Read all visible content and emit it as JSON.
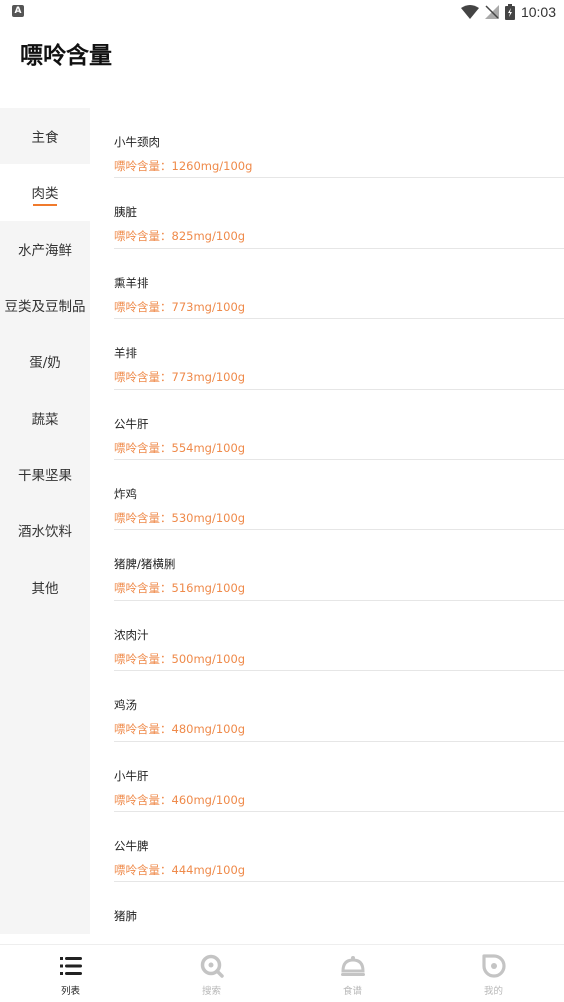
{
  "status_bar": {
    "time": "10:03",
    "left_badge": "A"
  },
  "app": {
    "title": "嘌呤含量"
  },
  "sidebar": {
    "items": [
      {
        "label": "主食"
      },
      {
        "label": "肉类"
      },
      {
        "label": "水产海鲜"
      },
      {
        "label": "豆类及豆制品"
      },
      {
        "label": "蛋/奶"
      },
      {
        "label": "蔬菜"
      },
      {
        "label": "干果坚果"
      },
      {
        "label": "酒水饮料"
      },
      {
        "label": "其他"
      }
    ],
    "active_index": 1
  },
  "list": {
    "items": [
      {
        "name": "小牛颈肉",
        "purine": "嘌呤含量：1260mg/100g"
      },
      {
        "name": "胰脏",
        "purine": "嘌呤含量：825mg/100g"
      },
      {
        "name": "熏羊排",
        "purine": "嘌呤含量：773mg/100g"
      },
      {
        "name": "羊排",
        "purine": "嘌呤含量：773mg/100g"
      },
      {
        "name": "公牛肝",
        "purine": "嘌呤含量：554mg/100g"
      },
      {
        "name": "炸鸡",
        "purine": "嘌呤含量：530mg/100g"
      },
      {
        "name": "猪脾/猪横脷",
        "purine": "嘌呤含量：516mg/100g"
      },
      {
        "name": "浓肉汁",
        "purine": "嘌呤含量：500mg/100g"
      },
      {
        "name": "鸡汤",
        "purine": "嘌呤含量：480mg/100g"
      },
      {
        "name": "小牛肝",
        "purine": "嘌呤含量：460mg/100g"
      },
      {
        "name": "公牛脾",
        "purine": "嘌呤含量：444mg/100g"
      },
      {
        "name": "猪肺",
        "purine": ""
      }
    ]
  },
  "bottom_nav": {
    "items": [
      {
        "label": "列表",
        "icon": "list-icon"
      },
      {
        "label": "搜索",
        "icon": "search-icon"
      },
      {
        "label": "食谱",
        "icon": "cloche-icon"
      },
      {
        "label": "我的",
        "icon": "profile-icon"
      }
    ],
    "active_index": 0
  },
  "colors": {
    "accent": "#f07a2c",
    "purine_text": "#ef8a4a",
    "sidebar_bg": "#f5f5f5",
    "nav_inactive": "#b8b8b8"
  }
}
